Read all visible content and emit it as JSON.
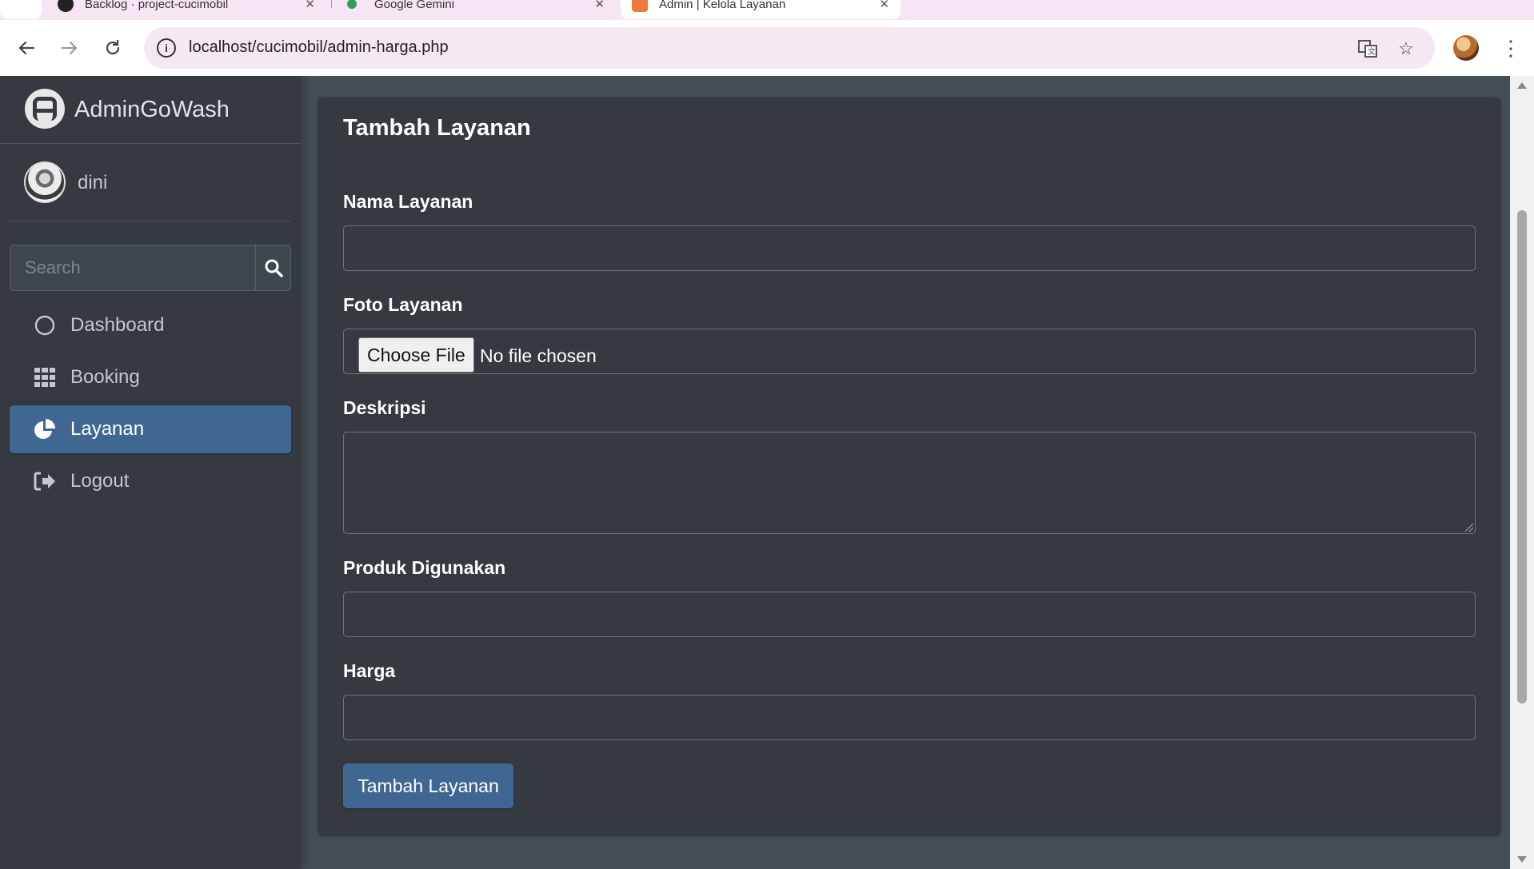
{
  "browser": {
    "tabs": [
      {
        "label": "Backlog · project-cucimobil",
        "icon": "github-icon"
      },
      {
        "label": "Google Gemini",
        "icon": "gemini-icon"
      },
      {
        "label": "Admin | Kelola Layanan",
        "icon": "page-favicon-icon"
      }
    ],
    "url": "localhost/cucimobil/admin-harga.php"
  },
  "sidebar": {
    "brand": "AdminGoWash",
    "user": "dini",
    "search_placeholder": "Search",
    "items": [
      {
        "label": "Dashboard",
        "icon": "circle-icon",
        "active": false
      },
      {
        "label": "Booking",
        "icon": "grid-icon",
        "active": false
      },
      {
        "label": "Layanan",
        "icon": "pie-chart-icon",
        "active": true
      },
      {
        "label": "Logout",
        "icon": "sign-out-icon",
        "active": false
      }
    ]
  },
  "form": {
    "title": "Tambah Layanan",
    "nama_label": "Nama Layanan",
    "foto_label": "Foto Layanan",
    "file_button": "Choose File",
    "file_status": "No file chosen",
    "deskripsi_label": "Deskripsi",
    "produk_label": "Produk Digunakan",
    "harga_label": "Harga",
    "submit_label": "Tambah Layanan"
  },
  "colors": {
    "sidebar_bg": "#343a40",
    "content_bg": "#454d55",
    "accent": "#3f6791"
  }
}
